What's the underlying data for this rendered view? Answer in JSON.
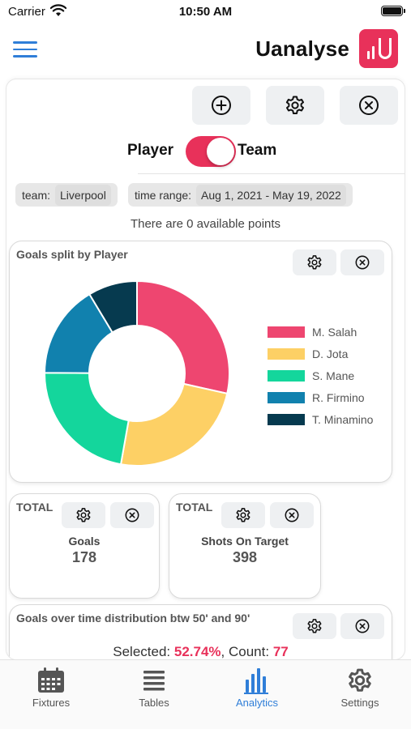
{
  "status_bar": {
    "carrier": "Carrier",
    "time": "10:50 AM"
  },
  "header": {
    "brand": "Uanalyse",
    "menu_icon": "hamburger-icon",
    "logo_icon": "uanalyse-logo"
  },
  "toolbar": {
    "add_icon": "plus-circle-icon",
    "settings_icon": "gear-icon",
    "close_icon": "close-circle-icon"
  },
  "toggle": {
    "left_label": "Player",
    "right_label": "Team",
    "selected": "Team",
    "accent": "#e8315a"
  },
  "filters": {
    "team_label": "team:",
    "team_value": "Liverpool",
    "range_label": "time range:",
    "range_value": "Aug 1, 2021 - May 19, 2022"
  },
  "available_text": "There are 0 available points",
  "pie_card": {
    "title": "Goals split by Player"
  },
  "chart_data": {
    "type": "pie",
    "variant": "doughnut",
    "title": "Goals split by Player",
    "series": [
      {
        "name": "M. Salah",
        "value": 0.285,
        "color": "#ee4670"
      },
      {
        "name": "D. Jota",
        "value": 0.243,
        "color": "#fdd065"
      },
      {
        "name": "S. Mane",
        "value": 0.223,
        "color": "#14d69c"
      },
      {
        "name": "R. Firmino",
        "value": 0.163,
        "color": "#1181ae"
      },
      {
        "name": "T. Minamino",
        "value": 0.086,
        "color": "#063a4f"
      }
    ],
    "legend": "right"
  },
  "stat_cards": [
    {
      "header": "TOTAL",
      "label": "Goals",
      "value": "178"
    },
    {
      "header": "TOTAL",
      "label": "Shots On Target",
      "value": "398"
    }
  ],
  "dist_card": {
    "title": "Goals over time distribution btw 50' and 90'",
    "selected_label": "Selected:",
    "selected_value": "52.74%",
    "count_label": ", Count:",
    "count_value": "77"
  },
  "tabs": [
    {
      "label": "Fixtures",
      "icon": "calendar-icon",
      "active": false
    },
    {
      "label": "Tables",
      "icon": "list-icon",
      "active": false
    },
    {
      "label": "Analytics",
      "icon": "bar-chart-icon",
      "active": true
    },
    {
      "label": "Settings",
      "icon": "gear-icon",
      "active": false
    }
  ]
}
